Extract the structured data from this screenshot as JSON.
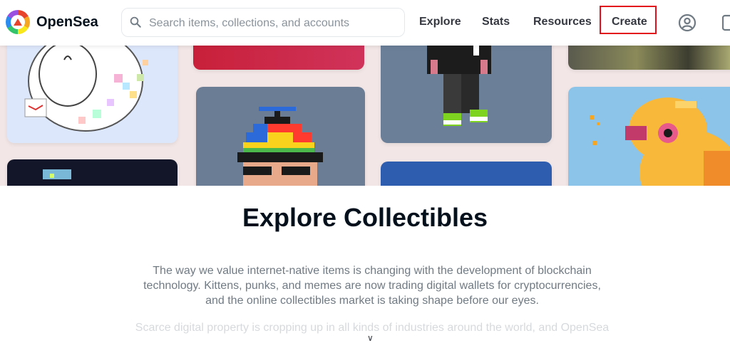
{
  "header": {
    "brand": "OpenSea",
    "search_placeholder": "Search items, collections, and accounts",
    "nav": {
      "explore": "Explore",
      "stats": "Stats",
      "resources": "Resources",
      "create": "Create"
    },
    "icons": {
      "logo": "opensea-logo-icon",
      "search": "search-icon",
      "profile": "account-circle-icon",
      "wallet": "wallet-icon"
    }
  },
  "main": {
    "title": "Explore Collectibles",
    "description": "The way we value internet-native items is changing with the development of blockchain technology. Kittens, punks, and memes are now trading digital wallets for cryptocurrencies, and the online collectibles market is taking shape before our eyes.",
    "description_faded": "Scarce digital property is cropping up in all kinds of industries around the world, and OpenSea"
  },
  "colors": {
    "highlight_box": "#e3101b",
    "text_primary": "#04111d",
    "text_secondary": "#707a83"
  }
}
